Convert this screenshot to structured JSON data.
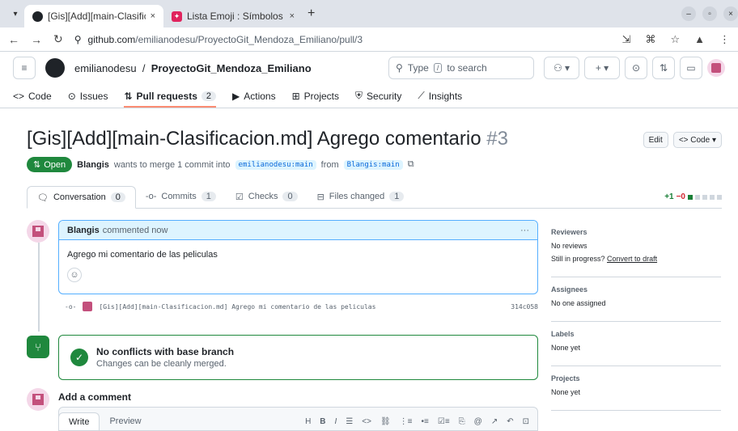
{
  "browser": {
    "tabs": [
      {
        "title": "[Gis][Add][main-Clasificac",
        "close": "×"
      },
      {
        "title": "Lista Emoji : Símbolos em",
        "close": "×"
      }
    ],
    "new_tab": "+",
    "url_domain": "github.com",
    "url_path": "/emilianodesu/ProyectoGit_Mendoza_Emiliano/pull/3"
  },
  "header": {
    "owner": "emilianodesu",
    "separator": "/",
    "repo": "ProyectoGit_Mendoza_Emiliano",
    "search_prefix": "Type",
    "search_key": "/",
    "search_suffix": "to search"
  },
  "repo_nav": [
    {
      "label": "Code",
      "icon": "<>",
      "count": ""
    },
    {
      "label": "Issues",
      "icon": "⊙",
      "count": ""
    },
    {
      "label": "Pull requests",
      "icon": "⇅",
      "count": "2"
    },
    {
      "label": "Actions",
      "icon": "▶",
      "count": ""
    },
    {
      "label": "Projects",
      "icon": "⊞",
      "count": ""
    },
    {
      "label": "Security",
      "icon": "⛨",
      "count": ""
    },
    {
      "label": "Insights",
      "icon": "⟋",
      "count": ""
    }
  ],
  "pr": {
    "title": "[Gis][Add][main-Clasificacion.md] Agrego comentario",
    "number": "#3",
    "edit_label": "Edit",
    "code_label": "<> Code",
    "status": "Open",
    "author": "Blangis",
    "merge_text": "wants to merge 1 commit into",
    "base_branch": "emilianodesu:main",
    "from_text": "from",
    "head_branch": "Blangis:main"
  },
  "pr_tabs": [
    {
      "label": "Conversation",
      "count": "0",
      "icon": "💬"
    },
    {
      "label": "Commits",
      "count": "1",
      "icon": "-o-"
    },
    {
      "label": "Checks",
      "count": "0",
      "icon": "☑"
    },
    {
      "label": "Files changed",
      "count": "1",
      "icon": "⊟"
    }
  ],
  "diffstat": {
    "plus": "+1",
    "minus": "−0"
  },
  "comment": {
    "author": "Blangis",
    "meta": "commented now",
    "body": "Agrego mi comentario de las peliculas",
    "menu": "···"
  },
  "commit": {
    "message": "[Gis][Add][main-Clasificacion.md] Agrego mi comentario de las peliculas",
    "sha": "314c058"
  },
  "merge": {
    "title": "No conflicts with base branch",
    "subtitle": "Changes can be cleanly merged."
  },
  "add_comment": {
    "title": "Add a comment",
    "write_tab": "Write",
    "preview_tab": "Preview"
  },
  "sidebar": {
    "reviewers_h": "Reviewers",
    "reviewers_v": "No reviews",
    "progress_text": "Still in progress?",
    "progress_link": "Convert to draft",
    "assignees_h": "Assignees",
    "assignees_v": "No one assigned",
    "labels_h": "Labels",
    "labels_v": "None yet",
    "projects_h": "Projects",
    "projects_v": "None yet"
  },
  "colors": {
    "accent": "#0969da",
    "open_green": "#1f883d",
    "active_tab_border": "#fd8c73"
  }
}
